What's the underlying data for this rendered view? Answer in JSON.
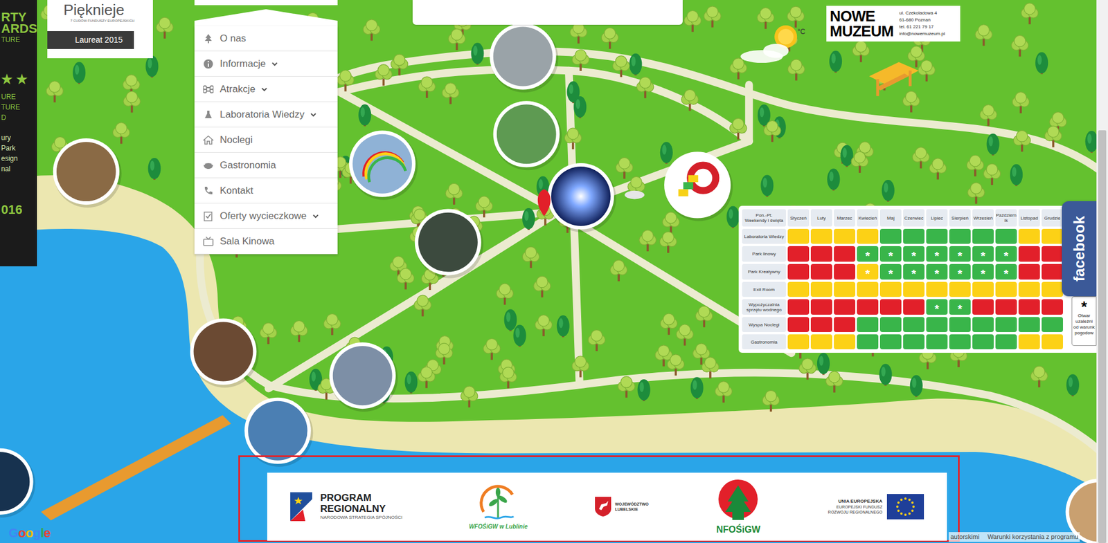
{
  "badge": {
    "title": "Pięknieje",
    "subtitle": "7 CUDÓW FUNDUSZY EUROPEJSKICH",
    "label": "Laureat 2015"
  },
  "side_strip": [
    [
      {
        "text": "RTY",
        "kind": "large",
        "color": "#8dc63f"
      },
      {
        "text": "ARDS",
        "kind": "large",
        "color": "#8dc63f"
      },
      {
        "text": "TURE",
        "kind": "small",
        "color": "#8dc63f"
      }
    ],
    [
      {
        "text": "★ ★",
        "kind": "large",
        "color": "#8dc63f"
      }
    ],
    [
      {
        "text": "URE",
        "kind": "small",
        "color": "#8dc63f"
      },
      {
        "text": "TURE",
        "kind": "small",
        "color": "#8dc63f"
      },
      {
        "text": "D",
        "kind": "small",
        "color": "#8dc63f"
      }
    ],
    [
      {
        "text": "ury",
        "kind": "small",
        "color": "#d6ecb4"
      },
      {
        "text": "Park",
        "kind": "small",
        "color": "#d6ecb4"
      },
      {
        "text": "esign",
        "kind": "small",
        "color": "#d6ecb4"
      },
      {
        "text": "nal",
        "kind": "small",
        "color": "#d6ecb4"
      }
    ],
    [
      {
        "text": "016",
        "kind": "large",
        "color": "#8dc63f"
      }
    ]
  ],
  "menu": {
    "items": [
      {
        "label": "O nas",
        "expandable": false
      },
      {
        "label": "Informacje",
        "expandable": true
      },
      {
        "label": "Atrakcje",
        "expandable": true
      },
      {
        "label": "Laboratoria Wiedzy",
        "expandable": true
      },
      {
        "label": "Noclegi",
        "expandable": false
      },
      {
        "label": "Gastronomia",
        "expandable": false
      },
      {
        "label": "Kontakt",
        "expandable": false
      },
      {
        "label": "Oferty wycieczkowe",
        "expandable": true
      },
      {
        "label": "Sala Kinowa",
        "expandable": false
      }
    ]
  },
  "museum": {
    "name_lines": [
      "NOWE",
      "MUZEUM"
    ],
    "address_lines": [
      "ul. Czekoladowa 4",
      "61-680 Poznań",
      "tel. 61 221 79 17",
      "info@nowemuzeum.pl"
    ]
  },
  "weather": {
    "unit": "°C"
  },
  "schedule": {
    "corner": [
      "Pon.-Pt.",
      "Weekendy i święta"
    ],
    "columns": [
      "Styczeń",
      "Luty",
      "Marzec",
      "Kwiecień",
      "Maj",
      "Czerwiec",
      "Lipiec",
      "Sierpień",
      "Wrzesień",
      "Październik",
      "Listopad",
      "Grudzie"
    ],
    "rows": [
      {
        "name": "Laboratoria Wiedzy",
        "cells": [
          {
            "color": "#fcd116",
            "text": ""
          },
          {
            "color": "#fcd116",
            "text": ""
          },
          {
            "color": "#fcd116",
            "text": ""
          },
          {
            "color": "#fcd116",
            "text": ""
          },
          {
            "color": "#39b54a",
            "text": ""
          },
          {
            "color": "#39b54a",
            "text": ""
          },
          {
            "color": "#39b54a",
            "text": ""
          },
          {
            "color": "#39b54a",
            "text": ""
          },
          {
            "color": "#39b54a",
            "text": ""
          },
          {
            "color": "#39b54a",
            "text": ""
          },
          {
            "color": "#fcd116",
            "text": ""
          },
          {
            "color": "#fcd116",
            "text": ""
          }
        ]
      },
      {
        "name": "Park linowy",
        "cells": [
          {
            "color": "#e2202a",
            "text": ""
          },
          {
            "color": "#e2202a",
            "text": ""
          },
          {
            "color": "#e2202a",
            "text": ""
          },
          {
            "color": "#39b54a",
            "text": "*"
          },
          {
            "color": "#39b54a",
            "text": "*"
          },
          {
            "color": "#39b54a",
            "text": "*"
          },
          {
            "color": "#39b54a",
            "text": "*"
          },
          {
            "color": "#39b54a",
            "text": "*"
          },
          {
            "color": "#39b54a",
            "text": "*"
          },
          {
            "color": "#39b54a",
            "text": "*"
          },
          {
            "color": "#e2202a",
            "text": ""
          },
          {
            "color": "#e2202a",
            "text": ""
          }
        ]
      },
      {
        "name": "Park Kreatywny",
        "cells": [
          {
            "color": "#e2202a",
            "text": ""
          },
          {
            "color": "#e2202a",
            "text": ""
          },
          {
            "color": "#e2202a",
            "text": ""
          },
          {
            "color": "#fcd116",
            "text": "*"
          },
          {
            "color": "#39b54a",
            "text": "*"
          },
          {
            "color": "#39b54a",
            "text": "*"
          },
          {
            "color": "#39b54a",
            "text": "*"
          },
          {
            "color": "#39b54a",
            "text": "*"
          },
          {
            "color": "#39b54a",
            "text": "*"
          },
          {
            "color": "#39b54a",
            "text": "*"
          },
          {
            "color": "#e2202a",
            "text": ""
          },
          {
            "color": "#e2202a",
            "text": ""
          }
        ]
      },
      {
        "name": "Exit Room",
        "cells": [
          {
            "color": "#fcd116",
            "text": ""
          },
          {
            "color": "#fcd116",
            "text": ""
          },
          {
            "color": "#fcd116",
            "text": ""
          },
          {
            "color": "#fcd116",
            "text": ""
          },
          {
            "color": "#fcd116",
            "text": ""
          },
          {
            "color": "#fcd116",
            "text": ""
          },
          {
            "color": "#fcd116",
            "text": ""
          },
          {
            "color": "#fcd116",
            "text": ""
          },
          {
            "color": "#fcd116",
            "text": ""
          },
          {
            "color": "#fcd116",
            "text": ""
          },
          {
            "color": "#fcd116",
            "text": ""
          },
          {
            "color": "#fcd116",
            "text": ""
          }
        ]
      },
      {
        "name": "Wypożyczalnia sprzętu wodnego",
        "cells": [
          {
            "color": "#e2202a",
            "text": ""
          },
          {
            "color": "#e2202a",
            "text": ""
          },
          {
            "color": "#e2202a",
            "text": ""
          },
          {
            "color": "#e2202a",
            "text": ""
          },
          {
            "color": "#e2202a",
            "text": ""
          },
          {
            "color": "#e2202a",
            "text": ""
          },
          {
            "color": "#39b54a",
            "text": "*"
          },
          {
            "color": "#39b54a",
            "text": "*"
          },
          {
            "color": "#e2202a",
            "text": ""
          },
          {
            "color": "#e2202a",
            "text": ""
          },
          {
            "color": "#e2202a",
            "text": ""
          },
          {
            "color": "#e2202a",
            "text": ""
          }
        ]
      },
      {
        "name": "Wyspa Noclegi",
        "cells": [
          {
            "color": "#e2202a",
            "text": ""
          },
          {
            "color": "#e2202a",
            "text": ""
          },
          {
            "color": "#e2202a",
            "text": ""
          },
          {
            "color": "#39b54a",
            "text": ""
          },
          {
            "color": "#39b54a",
            "text": ""
          },
          {
            "color": "#39b54a",
            "text": ""
          },
          {
            "color": "#39b54a",
            "text": ""
          },
          {
            "color": "#39b54a",
            "text": ""
          },
          {
            "color": "#39b54a",
            "text": ""
          },
          {
            "color": "#39b54a",
            "text": ""
          },
          {
            "color": "#39b54a",
            "text": ""
          },
          {
            "color": "#39b54a",
            "text": ""
          }
        ]
      },
      {
        "name": "Gastronomia",
        "cells": [
          {
            "color": "#fcd116",
            "text": ""
          },
          {
            "color": "#fcd116",
            "text": ""
          },
          {
            "color": "#fcd116",
            "text": ""
          },
          {
            "color": "#39b54a",
            "text": ""
          },
          {
            "color": "#39b54a",
            "text": ""
          },
          {
            "color": "#39b54a",
            "text": ""
          },
          {
            "color": "#39b54a",
            "text": ""
          },
          {
            "color": "#39b54a",
            "text": ""
          },
          {
            "color": "#39b54a",
            "text": ""
          },
          {
            "color": "#39b54a",
            "text": ""
          },
          {
            "color": "#fcd116",
            "text": ""
          },
          {
            "color": "#fcd116",
            "text": ""
          }
        ]
      }
    ]
  },
  "legend": {
    "symbol": "*",
    "lines": [
      "Otwar",
      "uzależni",
      "od warunk",
      "pogodow"
    ]
  },
  "facebook": {
    "label": "facebook"
  },
  "sponsors": [
    {
      "kind": "program",
      "lines": [
        "PROGRAM",
        "REGIONALNY"
      ],
      "sub": "NARODOWA STRATEGIA SPÓJNOŚCI"
    },
    {
      "kind": "wfos",
      "lines": [
        "WFOŚiGW w Lublinie"
      ],
      "sub": ""
    },
    {
      "kind": "lubelskie",
      "lines": [
        "WOJEWÓDZTWO",
        "LUBELSKIE"
      ],
      "sub": ""
    },
    {
      "kind": "nfos",
      "lines": [
        "NFOŚiGW"
      ],
      "sub": ""
    },
    {
      "kind": "ue",
      "lines": [
        "UNIA EUROPEJSKA",
        "EUROPEJSKI FUNDUSZ",
        "ROZWOJU REGIONALNEGO"
      ],
      "sub": ""
    }
  ],
  "map_footer": {
    "logo": "Google",
    "links": [
      "autorskimi",
      "Warunki korzystania z programu"
    ]
  }
}
